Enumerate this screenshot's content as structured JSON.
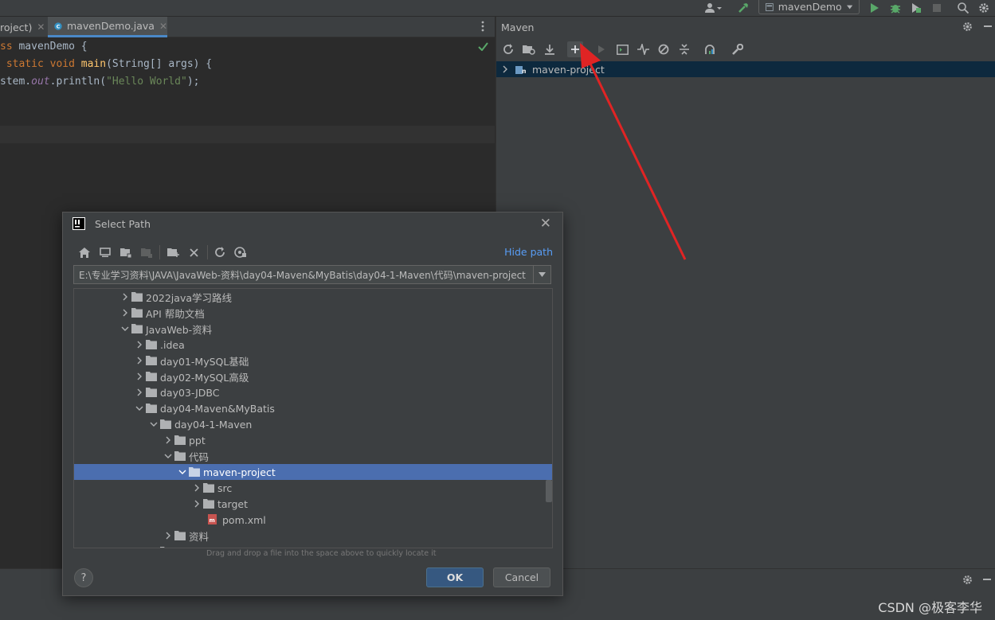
{
  "topbar": {
    "run_config_label": "mavenDemo"
  },
  "editor": {
    "tabs": [
      {
        "label": "roject)"
      },
      {
        "label": "mavenDemo.java"
      }
    ],
    "code": {
      "l1_kw": "ss",
      "l1_rest": " mavenDemo {",
      "l2_kw1": "static",
      "l2_kw2": "void",
      "l2_fn": "main",
      "l2_rest": "(String[] args) {",
      "l3_a": "stem.",
      "l3_out": "out",
      "l3_b": ".println(",
      "l3_str": "\"Hello World\"",
      "l3_c": ");"
    }
  },
  "maven": {
    "title": "Maven",
    "project_label": "maven-project"
  },
  "dialog": {
    "title": "Select Path",
    "hide_path_label": "Hide path",
    "path_value": "E:\\专业学习资料\\JAVA\\JavaWeb-资料\\day04-Maven&MyBatis\\day04-1-Maven\\代码\\maven-project",
    "tree": [
      {
        "label": "2022java学习路线"
      },
      {
        "label": "API 帮助文档"
      },
      {
        "label": "JavaWeb-资料"
      },
      {
        "label": ".idea"
      },
      {
        "label": "day01-MySQL基础"
      },
      {
        "label": "day02-MySQL高级"
      },
      {
        "label": "day03-JDBC"
      },
      {
        "label": "day04-Maven&MyBatis"
      },
      {
        "label": "day04-1-Maven"
      },
      {
        "label": "ppt"
      },
      {
        "label": "代码"
      },
      {
        "label": "maven-project"
      },
      {
        "label": "src"
      },
      {
        "label": "target"
      },
      {
        "label": "pom.xml"
      },
      {
        "label": "资料"
      }
    ],
    "drag_hint": "Drag and drop a file into the space above to quickly locate it",
    "help_label": "?",
    "ok_label": "OK",
    "cancel_label": "Cancel"
  },
  "watermark": "CSDN @极客李华",
  "colors": {
    "accent": "#4b6eaf",
    "link": "#589df6",
    "arrow": "#e02424"
  }
}
